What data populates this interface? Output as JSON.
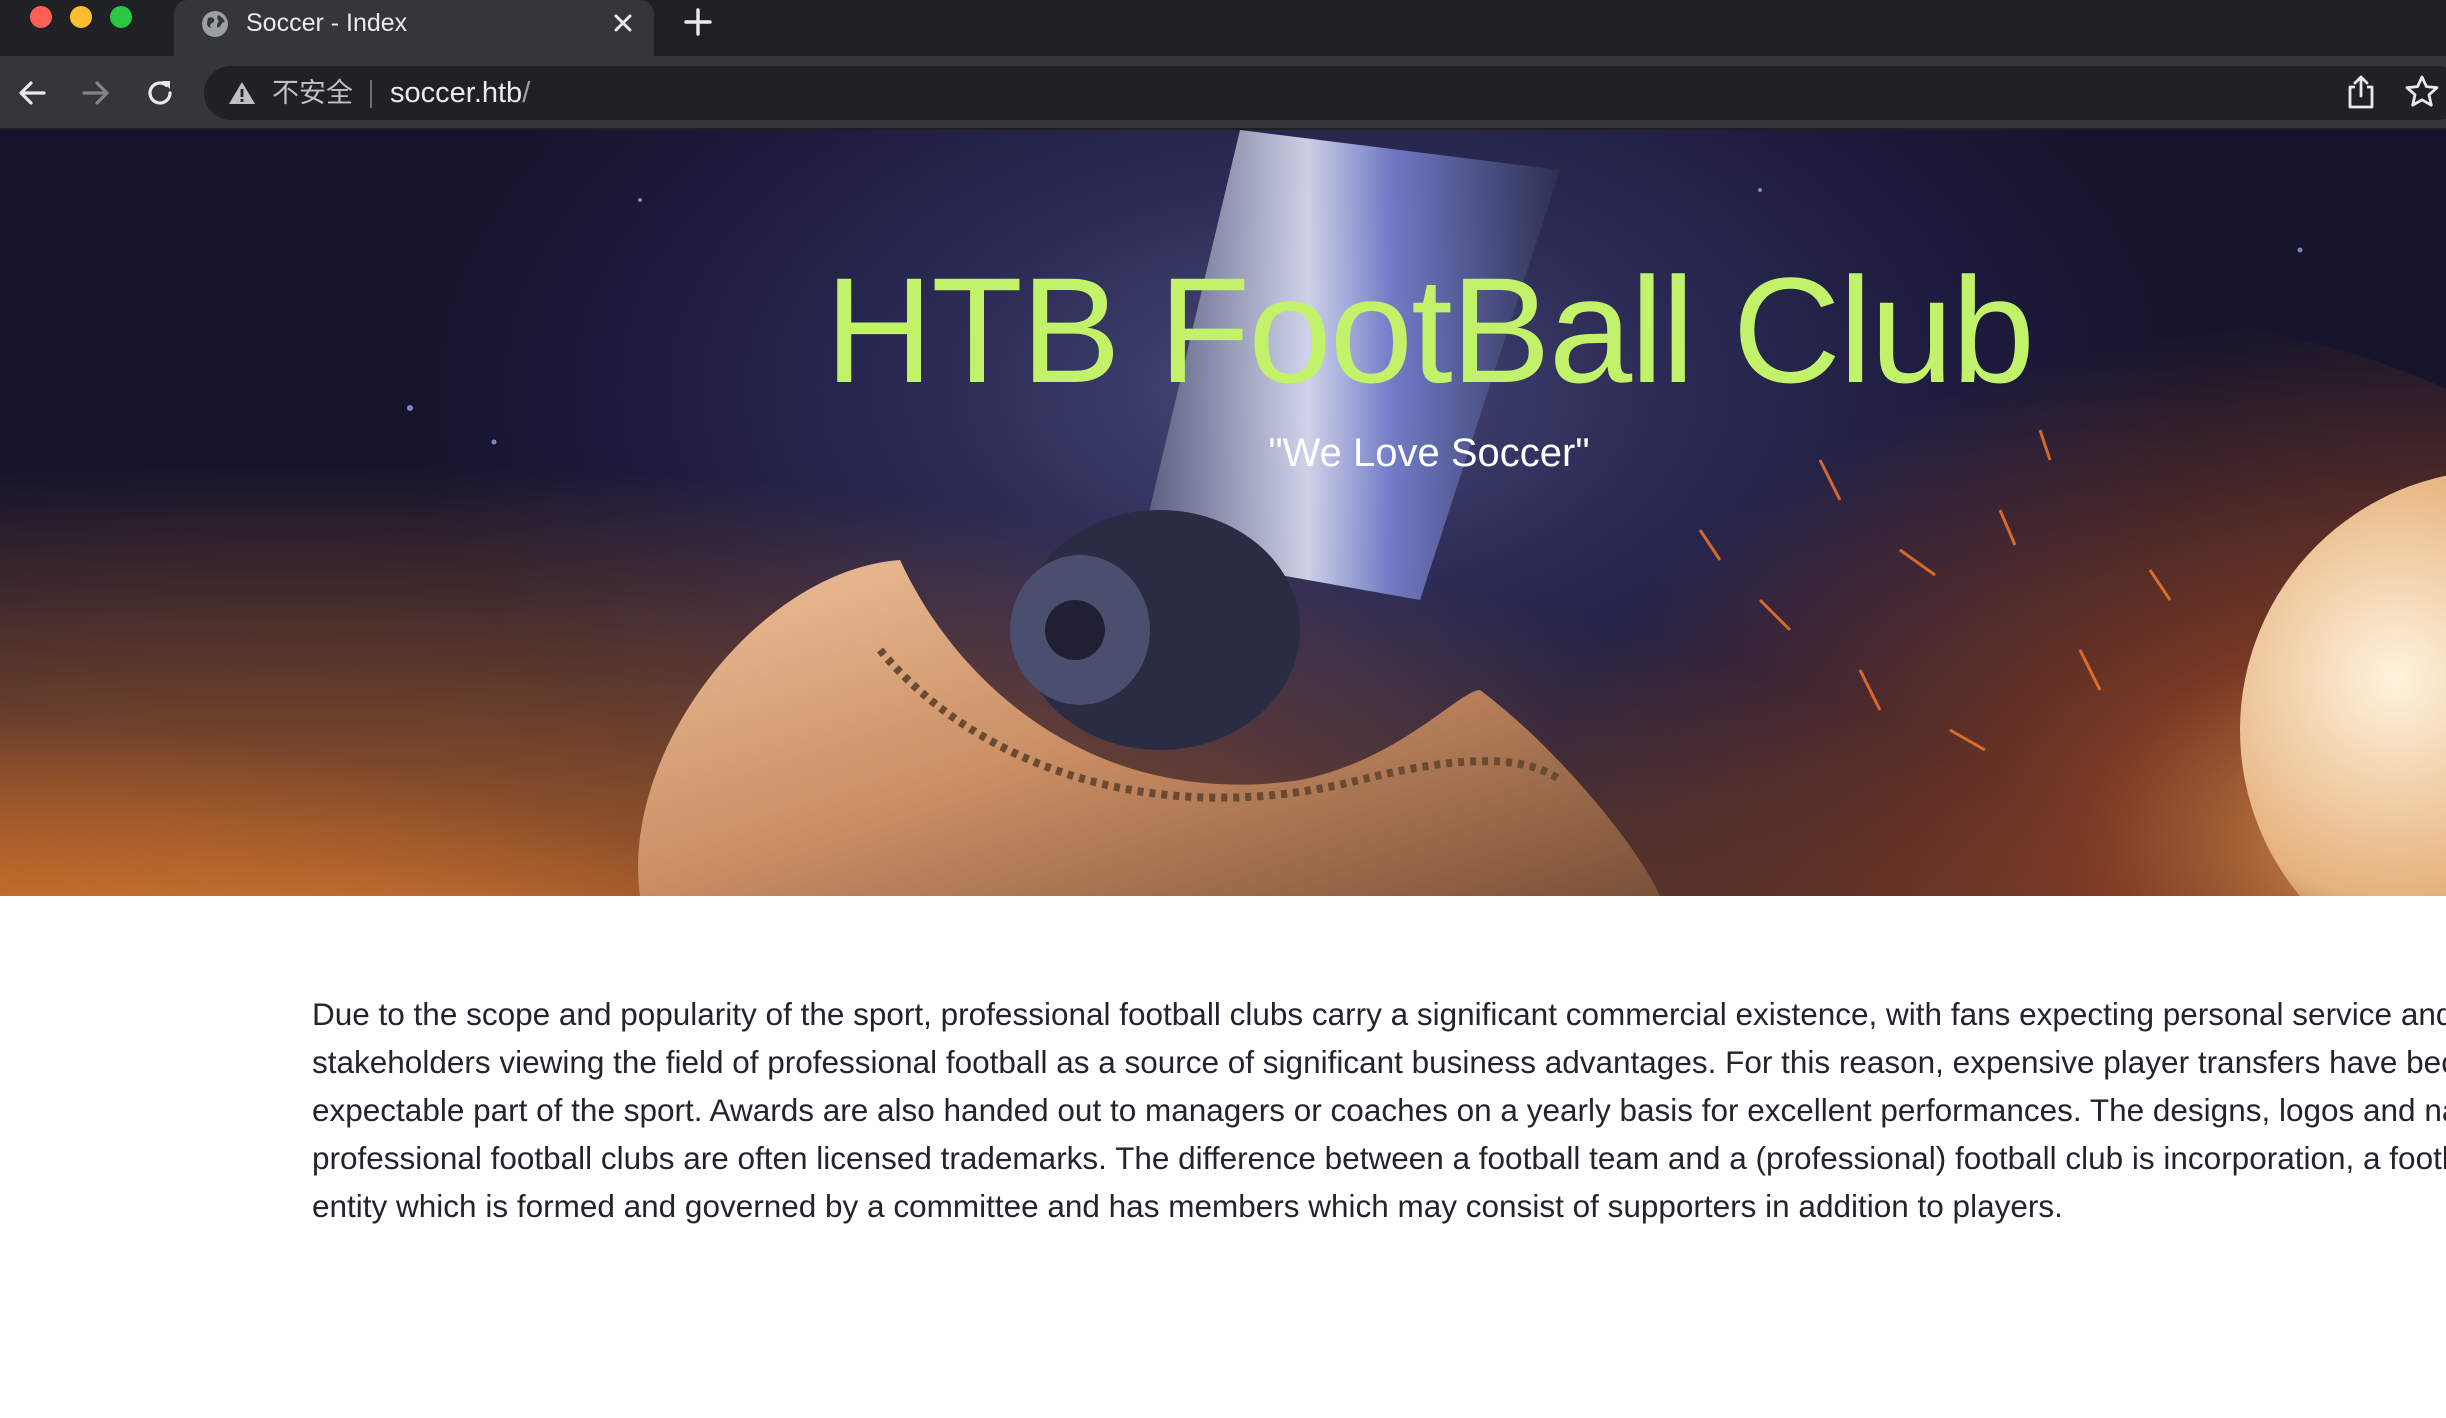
{
  "browser": {
    "tab": {
      "title": "Soccer - Index",
      "favicon": "globe-icon",
      "close_icon": "close-icon"
    },
    "new_tab_icon": "plus-icon",
    "nav": {
      "back_icon": "arrow-left-icon",
      "forward_icon": "arrow-right-icon",
      "reload_icon": "reload-icon"
    },
    "omnibox": {
      "security_icon": "warning-icon",
      "security_label": "不安全",
      "url_host": "soccer.htb",
      "url_path": "/"
    },
    "actions": {
      "share_icon": "share-icon",
      "bookmark_icon": "star-icon"
    }
  },
  "hero": {
    "title": "HTB FootBall Club",
    "subtitle": "\"We Love Soccer\""
  },
  "content": {
    "paragraph": "Due to the scope and popularity of the sport, professional football clubs carry a significant commercial existence, with fans expecting personal service and interactivity, and stakeholders viewing the field of professional football as a source of significant business advantages. For this reason, expensive player transfers have become an expectable part of the sport. Awards are also handed out to managers or coaches on a yearly basis for excellent performances. The designs, logos and names of professional football clubs are often licensed trademarks. The difference between a football team and a (professional) football club is incorporation, a football club is an entity which is formed and governed by a committee and has members which may consist of supporters in addition to players."
  },
  "colors": {
    "title_accent": "#c1f26a",
    "chrome_dark": "#202124",
    "chrome_toolbar": "#35363a"
  }
}
